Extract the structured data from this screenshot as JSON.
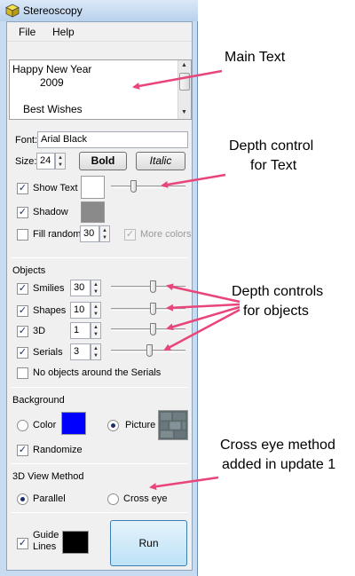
{
  "window": {
    "title": "Stereoscopy"
  },
  "menu": {
    "file": "File",
    "help": "Help"
  },
  "main_text": {
    "line1": "Happy New Year",
    "line2": "2009",
    "line3": "Best Wishes"
  },
  "font": {
    "label": "Font:",
    "value": "Arial Black"
  },
  "size": {
    "label": "Size:",
    "value": "24",
    "bold": "Bold",
    "italic": "Italic"
  },
  "text_options": {
    "show_text": "Show Text",
    "shadow": "Shadow",
    "fill_random": "Fill random",
    "fill_random_value": "30",
    "more_colors": "More colors"
  },
  "objects": {
    "group": "Objects",
    "smilies": {
      "label": "Smilies",
      "value": "30"
    },
    "shapes": {
      "label": "Shapes",
      "value": "10"
    },
    "three_d": {
      "label": "3D",
      "value": "1"
    },
    "serials": {
      "label": "Serials",
      "value": "3"
    },
    "no_objects": "No objects around the Serials"
  },
  "background": {
    "group": "Background",
    "color": "Color",
    "picture": "Picture",
    "randomize": "Randomize",
    "color_value": "#0000ff"
  },
  "view_method": {
    "group": "3D View Method",
    "parallel": "Parallel",
    "cross_eye": "Cross eye"
  },
  "bottom": {
    "guide_lines": "Guide\nLines",
    "run": "Run"
  },
  "annotations": {
    "main_text": "Main Text",
    "depth_text_1": "Depth control",
    "depth_text_2": "for Text",
    "depth_objects_1": "Depth controls",
    "depth_objects_2": "for objects",
    "cross_eye_1": "Cross eye method",
    "cross_eye_2": "added in update 1"
  },
  "colors": {
    "arrow": "#e8457a",
    "window_frame": "#c7dcf1"
  }
}
